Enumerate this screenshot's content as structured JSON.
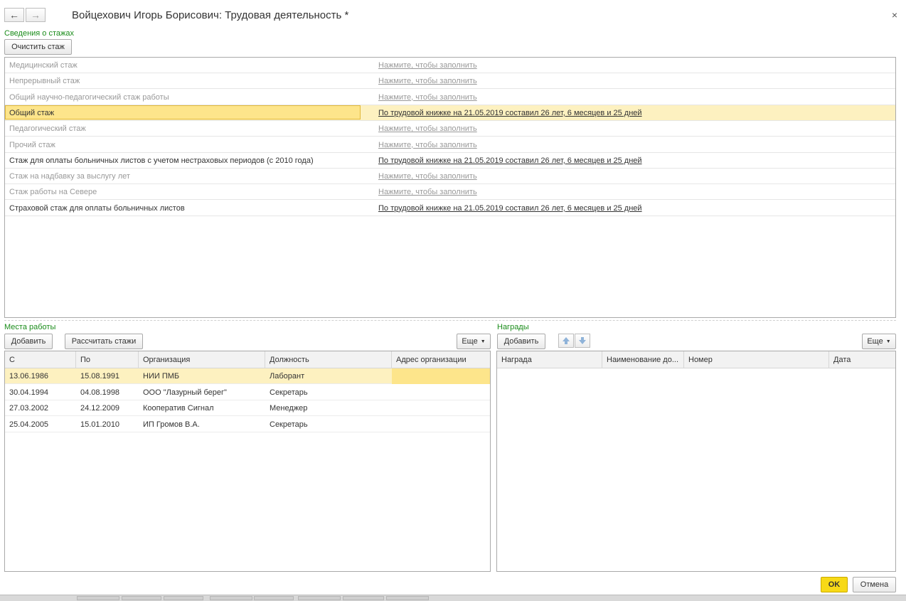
{
  "window": {
    "title": "Войцехович Игорь Борисович: Трудовая деятельность *",
    "back_icon": "←",
    "forward_icon": "→",
    "close_icon": "×"
  },
  "stazh_section": {
    "label": "Сведения о стажах",
    "clear_button": "Очистить стаж",
    "rows": [
      {
        "name": "Медицинский стаж",
        "value": "Нажмите, чтобы заполнить",
        "filled": false
      },
      {
        "name": "Непрерывный стаж",
        "value": "Нажмите, чтобы заполнить",
        "filled": false
      },
      {
        "name": "Общий научно-педагогический стаж работы",
        "value": "Нажмите, чтобы заполнить",
        "filled": false
      },
      {
        "name": "Общий стаж",
        "value": "По трудовой книжке на 21.05.2019 составил 26 лет, 6 месяцев и 25 дней",
        "filled": true,
        "selected": true
      },
      {
        "name": "Педагогический стаж",
        "value": "Нажмите, чтобы заполнить",
        "filled": false
      },
      {
        "name": "Прочий стаж",
        "value": "Нажмите, чтобы заполнить",
        "filled": false
      },
      {
        "name": "Стаж для оплаты больничных листов с учетом нестраховых периодов (с 2010 года)",
        "value": "По трудовой книжке на 21.05.2019 составил 26 лет, 6 месяцев и 25 дней",
        "filled": true
      },
      {
        "name": "Стаж на надбавку за выслугу лет",
        "value": "Нажмите, чтобы заполнить",
        "filled": false
      },
      {
        "name": "Стаж работы на Севере",
        "value": "Нажмите, чтобы заполнить",
        "filled": false
      },
      {
        "name": "Страховой стаж для оплаты больничных листов",
        "value": "По трудовой книжке на 21.05.2019 составил 26 лет, 6 месяцев и 25 дней",
        "filled": true
      }
    ]
  },
  "workplaces": {
    "label": "Места работы",
    "add_button": "Добавить",
    "calc_button": "Рассчитать стажи",
    "more_button": "Еще",
    "columns": [
      "С",
      "По",
      "Организация",
      "Должность",
      "Адрес организации"
    ],
    "rows": [
      [
        "13.06.1986",
        "15.08.1991",
        "НИИ ПМБ",
        "Лаборант",
        ""
      ],
      [
        "30.04.1994",
        "04.08.1998",
        "ООО \"Лазурный берег\"",
        "Секретарь",
        ""
      ],
      [
        "27.03.2002",
        "24.12.2009",
        "Кооператив Сигнал",
        "Менеджер",
        ""
      ],
      [
        "25.04.2005",
        "15.01.2010",
        "ИП Громов В.А.",
        "Секретарь",
        ""
      ]
    ]
  },
  "awards": {
    "label": "Награды",
    "add_button": "Добавить",
    "more_button": "Еще",
    "columns": [
      "Награда",
      "Наименование до...",
      "Номер",
      "Дата"
    ]
  },
  "footer": {
    "ok_button": "OK",
    "cancel_button": "Отмена"
  },
  "colors": {
    "accent_green": "#1a8c1a",
    "selection": "#fde58b",
    "ok_button": "#f7d917"
  }
}
